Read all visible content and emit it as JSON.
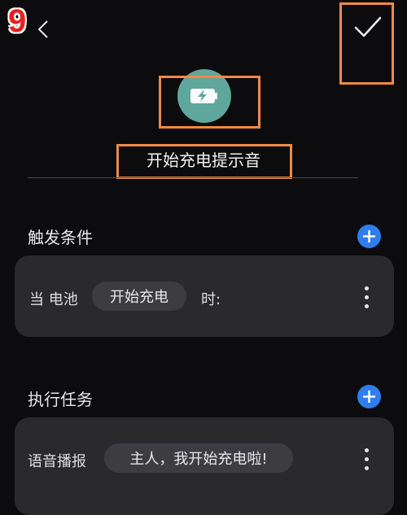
{
  "step_badge": "9",
  "automation": {
    "title": "开始充电提示音",
    "icon": "battery-charging-icon"
  },
  "trigger_section": {
    "title": "触发条件",
    "condition": {
      "prefix": "当 电池",
      "value": "开始充电",
      "suffix": "时:"
    }
  },
  "task_section": {
    "title": "执行任务",
    "task": {
      "label": "语音播报",
      "value": "主人，我开始充电啦!"
    }
  },
  "colors": {
    "accent_blue": "#2f7ef0",
    "icon_teal": "#5fa69c",
    "highlight_orange": "#ee8a47",
    "step_red": "#e8211c"
  }
}
